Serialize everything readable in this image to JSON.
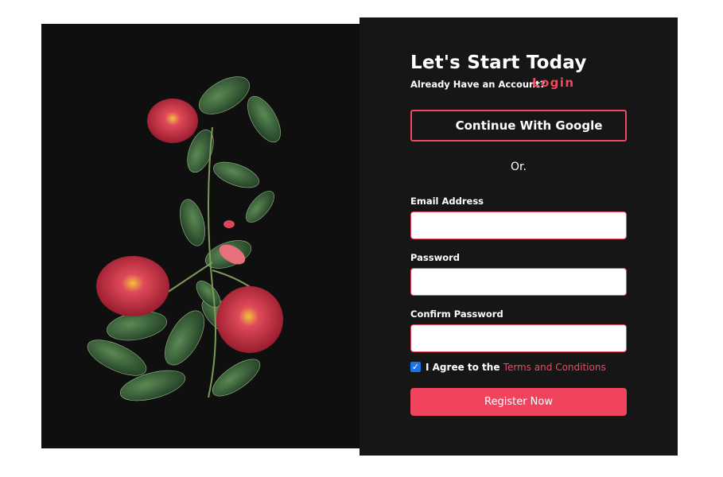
{
  "hero_image": {
    "icon": "rose-silhouette-illustration",
    "background": "#0f0f0f"
  },
  "header": {
    "title": "Let's Start Today",
    "have_account": "Already Have an Account?",
    "login_label": "Login"
  },
  "google_button": {
    "label": "Continue With Google"
  },
  "divider": {
    "text": "Or."
  },
  "form": {
    "email_label": "Email Address",
    "email_value": "",
    "password_label": "Password",
    "password_value": "",
    "confirm_label": "Confirm Password",
    "confirm_value": ""
  },
  "agreement": {
    "checked": true,
    "prefix": "I Agree to the",
    "link": "Terms and Conditions"
  },
  "register_button": {
    "label": "Register Now"
  },
  "colors": {
    "accent": "#f0485f",
    "panel": "#161616",
    "checkbox": "#1a73e8"
  }
}
